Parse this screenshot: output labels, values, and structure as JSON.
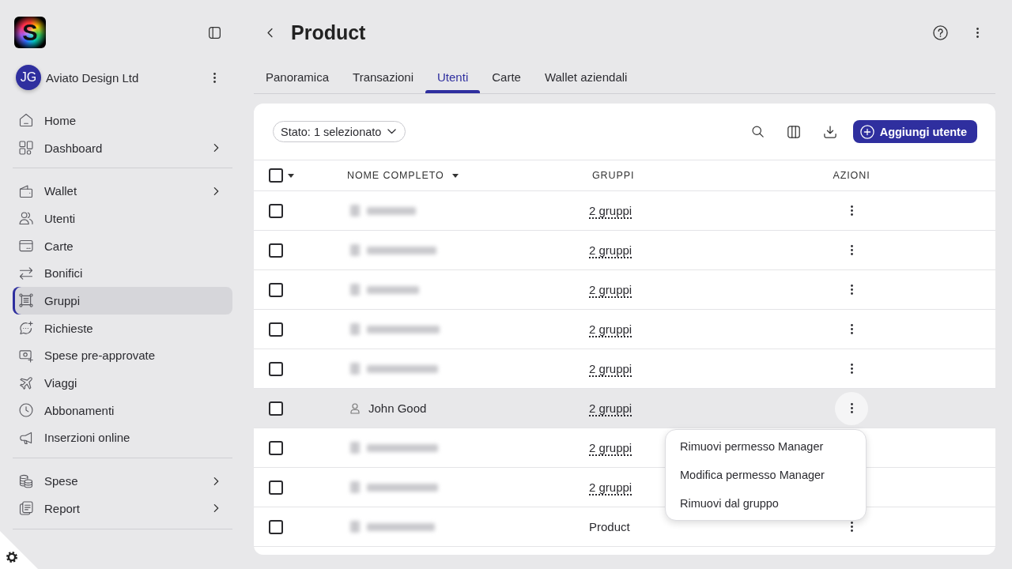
{
  "sidebar": {
    "logo": {
      "letter": "S"
    },
    "account": {
      "initials": "JG",
      "name": "Aviato Design Ltd"
    },
    "sections": [
      {
        "items": [
          {
            "label": "Home",
            "kind": "link",
            "selected": false
          },
          {
            "label": "Dashboard",
            "kind": "submenu",
            "selected": false
          }
        ]
      },
      {
        "items": [
          {
            "label": "Wallet",
            "kind": "submenu",
            "selected": false
          },
          {
            "label": "Utenti",
            "kind": "link",
            "selected": false
          },
          {
            "label": "Carte",
            "kind": "link",
            "selected": false
          },
          {
            "label": "Bonifici",
            "kind": "link",
            "selected": false
          },
          {
            "label": "Gruppi",
            "kind": "link",
            "selected": true
          },
          {
            "label": "Richieste",
            "kind": "link",
            "selected": false
          },
          {
            "label": "Spese pre-approvate",
            "kind": "link",
            "selected": false
          },
          {
            "label": "Viaggi",
            "kind": "link",
            "selected": false
          },
          {
            "label": "Abbonamenti",
            "kind": "link",
            "selected": false
          },
          {
            "label": "Inserzioni online",
            "kind": "link",
            "selected": false
          }
        ]
      },
      {
        "items": [
          {
            "label": "Spese",
            "kind": "submenu",
            "selected": false
          },
          {
            "label": "Report",
            "kind": "submenu",
            "selected": false
          }
        ]
      }
    ]
  },
  "header": {
    "title": "Product"
  },
  "tabs": [
    {
      "label": "Panoramica",
      "selected": false
    },
    {
      "label": "Transazioni",
      "selected": false
    },
    {
      "label": "Utenti",
      "selected": true
    },
    {
      "label": "Carte",
      "selected": false
    },
    {
      "label": "Wallet aziendali",
      "selected": false
    }
  ],
  "toolbar": {
    "filter": "Stato: 1 selezionato",
    "add_button": "Aggiungi utente"
  },
  "table": {
    "select_all": {
      "checked": false
    },
    "columns": [
      {
        "label": "NOME COMPLETO",
        "sorted": true
      },
      {
        "label": "GRUPPI",
        "sorted": false
      },
      {
        "label": "AZIONI",
        "sorted": false
      }
    ],
    "rows": [
      {
        "checked": false,
        "blurred": true,
        "groups": "2 gruppi",
        "groups_underlined": true,
        "highlighted": false
      },
      {
        "checked": false,
        "blurred": true,
        "groups": "2 gruppi",
        "groups_underlined": true,
        "highlighted": false
      },
      {
        "checked": false,
        "blurred": true,
        "groups": "2 gruppi",
        "groups_underlined": true,
        "highlighted": false
      },
      {
        "checked": false,
        "blurred": true,
        "groups": "2 gruppi",
        "groups_underlined": true,
        "highlighted": false
      },
      {
        "checked": false,
        "blurred": true,
        "groups": "2 gruppi",
        "groups_underlined": true,
        "highlighted": false
      },
      {
        "checked": false,
        "blurred": false,
        "name": "John Good",
        "groups": "2 gruppi",
        "groups_underlined": true,
        "highlighted": true
      },
      {
        "checked": false,
        "blurred": true,
        "groups": "2 gruppi",
        "groups_underlined": true,
        "highlighted": false
      },
      {
        "checked": false,
        "blurred": true,
        "groups": "2 gruppi",
        "groups_underlined": true,
        "highlighted": false
      },
      {
        "checked": false,
        "blurred": true,
        "groups": "Product",
        "groups_underlined": false,
        "highlighted": false
      }
    ],
    "row_menu": {
      "open": true,
      "items": [
        "Rimuovi permesso Manager",
        "Modifica permesso Manager",
        "Rimuovi dal gruppo"
      ]
    }
  }
}
